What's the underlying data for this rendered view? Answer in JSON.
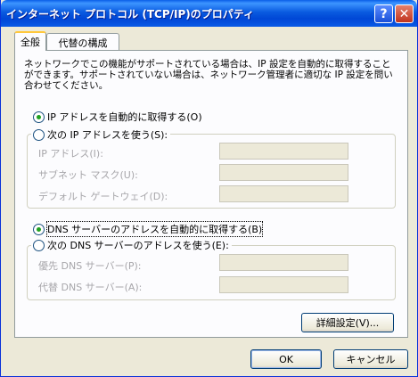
{
  "window": {
    "title": "インターネット プロトコル (TCP/IP)のプロパティ",
    "help_label": "?",
    "close_label": "✕"
  },
  "tabs": [
    {
      "label": "全般"
    },
    {
      "label": "代替の構成"
    }
  ],
  "description": "ネットワークでこの機能がサポートされている場合は、IP 設定を自動的に取得することができます。サポートされていない場合は、ネットワーク管理者に適切な IP 設定を問い合わせてください。",
  "ip": {
    "auto_label": "IP アドレスを自動的に取得する(O)",
    "manual_label": "次の IP アドレスを使う(S):",
    "fields": [
      {
        "label": "IP アドレス(I):",
        "value": ""
      },
      {
        "label": "サブネット マスク(U):",
        "value": ""
      },
      {
        "label": "デフォルト ゲートウェイ(D):",
        "value": ""
      }
    ]
  },
  "dns": {
    "auto_label": "DNS サーバーのアドレスを自動的に取得する(B)",
    "manual_label": "次の DNS サーバーのアドレスを使う(E):",
    "fields": [
      {
        "label": "優先 DNS サーバー(P):",
        "value": ""
      },
      {
        "label": "代替 DNS サーバー(A):",
        "value": ""
      }
    ]
  },
  "buttons": {
    "advanced": "詳細設定(V)...",
    "ok": "OK",
    "cancel": "キャンセル"
  },
  "colors": {
    "title_bar": "#0a5be0",
    "radio_dot": "#21a121",
    "disabled_text": "#a7a6aa"
  }
}
